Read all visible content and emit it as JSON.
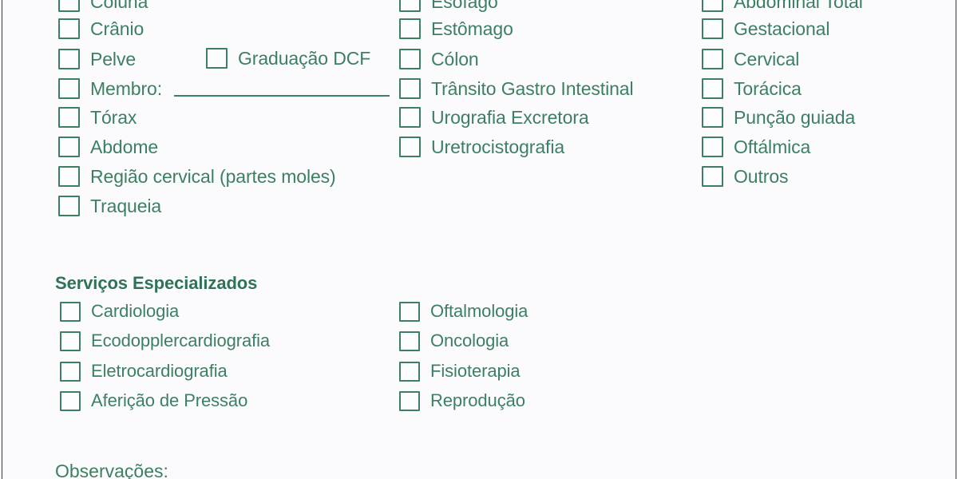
{
  "theme": {
    "accent_green": "#3d7f62",
    "heading_green": "#2f7256",
    "page_background": "#fbfbfd",
    "edge_rule": "#3a3a3e"
  },
  "exam_columns": {
    "column_1": [
      {
        "label": "Coluna",
        "checked": false
      },
      {
        "label": "Crânio",
        "checked": false
      },
      {
        "label": "Pelve",
        "checked": false
      },
      {
        "label": "Membro:",
        "checked": false,
        "has_fill_line": true
      },
      {
        "label": "Tórax",
        "checked": false
      },
      {
        "label": "Abdome",
        "checked": false
      },
      {
        "label": "Região cervical (partes moles)",
        "checked": false
      },
      {
        "label": "Traqueia",
        "checked": false
      }
    ],
    "column_1_extra": {
      "label": "Graduação DCF",
      "checked": false
    },
    "column_2": [
      {
        "label": "Esôfago",
        "checked": false
      },
      {
        "label": "Estômago",
        "checked": false
      },
      {
        "label": "Cólon",
        "checked": false
      },
      {
        "label": "Trânsito Gastro Intestinal",
        "checked": false
      },
      {
        "label": "Urografia Excretora",
        "checked": false
      },
      {
        "label": "Uretrocistografia",
        "checked": false
      }
    ],
    "column_3": [
      {
        "label": "Abdominal Total",
        "checked": false
      },
      {
        "label": "Gestacional",
        "checked": false
      },
      {
        "label": "Cervical",
        "checked": false
      },
      {
        "label": "Torácica",
        "checked": false
      },
      {
        "label": "Punção guiada",
        "checked": false
      },
      {
        "label": "Oftálmica",
        "checked": false
      },
      {
        "label": "Outros",
        "checked": false
      }
    ]
  },
  "specialized_services": {
    "heading": "Serviços Especializados",
    "column_1": [
      {
        "label": "Cardiologia",
        "checked": false
      },
      {
        "label": "Ecodopplercardiografia",
        "checked": false
      },
      {
        "label": "Eletrocardiografia",
        "checked": false
      },
      {
        "label": "Aferição de Pressão",
        "checked": false
      }
    ],
    "column_2": [
      {
        "label": "Oftalmologia",
        "checked": false
      },
      {
        "label": "Oncologia",
        "checked": false
      },
      {
        "label": "Fisioterapia",
        "checked": false
      },
      {
        "label": "Reprodução",
        "checked": false
      }
    ]
  },
  "observations": {
    "label": "Observações:",
    "value": ""
  }
}
